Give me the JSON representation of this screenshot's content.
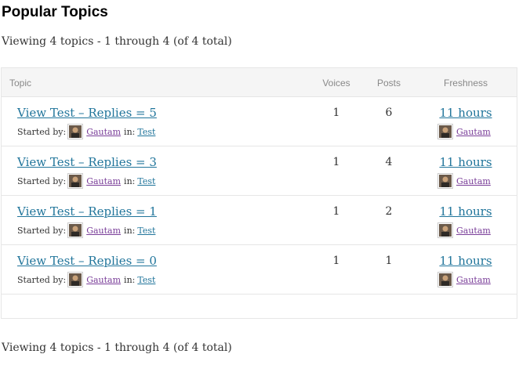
{
  "page": {
    "title": "Popular Topics",
    "pagination_text": "Viewing 4 topics - 1 through 4 (of 4 total)"
  },
  "table": {
    "headers": {
      "topic": "Topic",
      "voices": "Voices",
      "posts": "Posts",
      "freshness": "Freshness"
    },
    "started_by_label": "Started by:",
    "in_label": "in:",
    "rows": [
      {
        "title": "View Test – Replies = 5",
        "author": "Gautam",
        "forum": "Test",
        "voices": "1",
        "posts": "6",
        "freshness": "11 hours",
        "last_author": "Gautam",
        "avatar_icon": "user-avatar-icon"
      },
      {
        "title": "View Test – Replies = 3",
        "author": "Gautam",
        "forum": "Test",
        "voices": "1",
        "posts": "4",
        "freshness": "11 hours",
        "last_author": "Gautam",
        "avatar_icon": "user-avatar-icon"
      },
      {
        "title": "View Test – Replies = 1",
        "author": "Gautam",
        "forum": "Test",
        "voices": "1",
        "posts": "2",
        "freshness": "11 hours",
        "last_author": "Gautam",
        "avatar_icon": "user-avatar-icon"
      },
      {
        "title": "View Test – Replies = 0",
        "author": "Gautam",
        "forum": "Test",
        "voices": "1",
        "posts": "1",
        "freshness": "11 hours",
        "last_author": "Gautam",
        "avatar_icon": "user-avatar-icon"
      }
    ]
  },
  "colors": {
    "link": "#21759b",
    "visited_link": "#7a3e99",
    "header_bg": "#f5f5f5",
    "border": "#e6e6e6"
  }
}
